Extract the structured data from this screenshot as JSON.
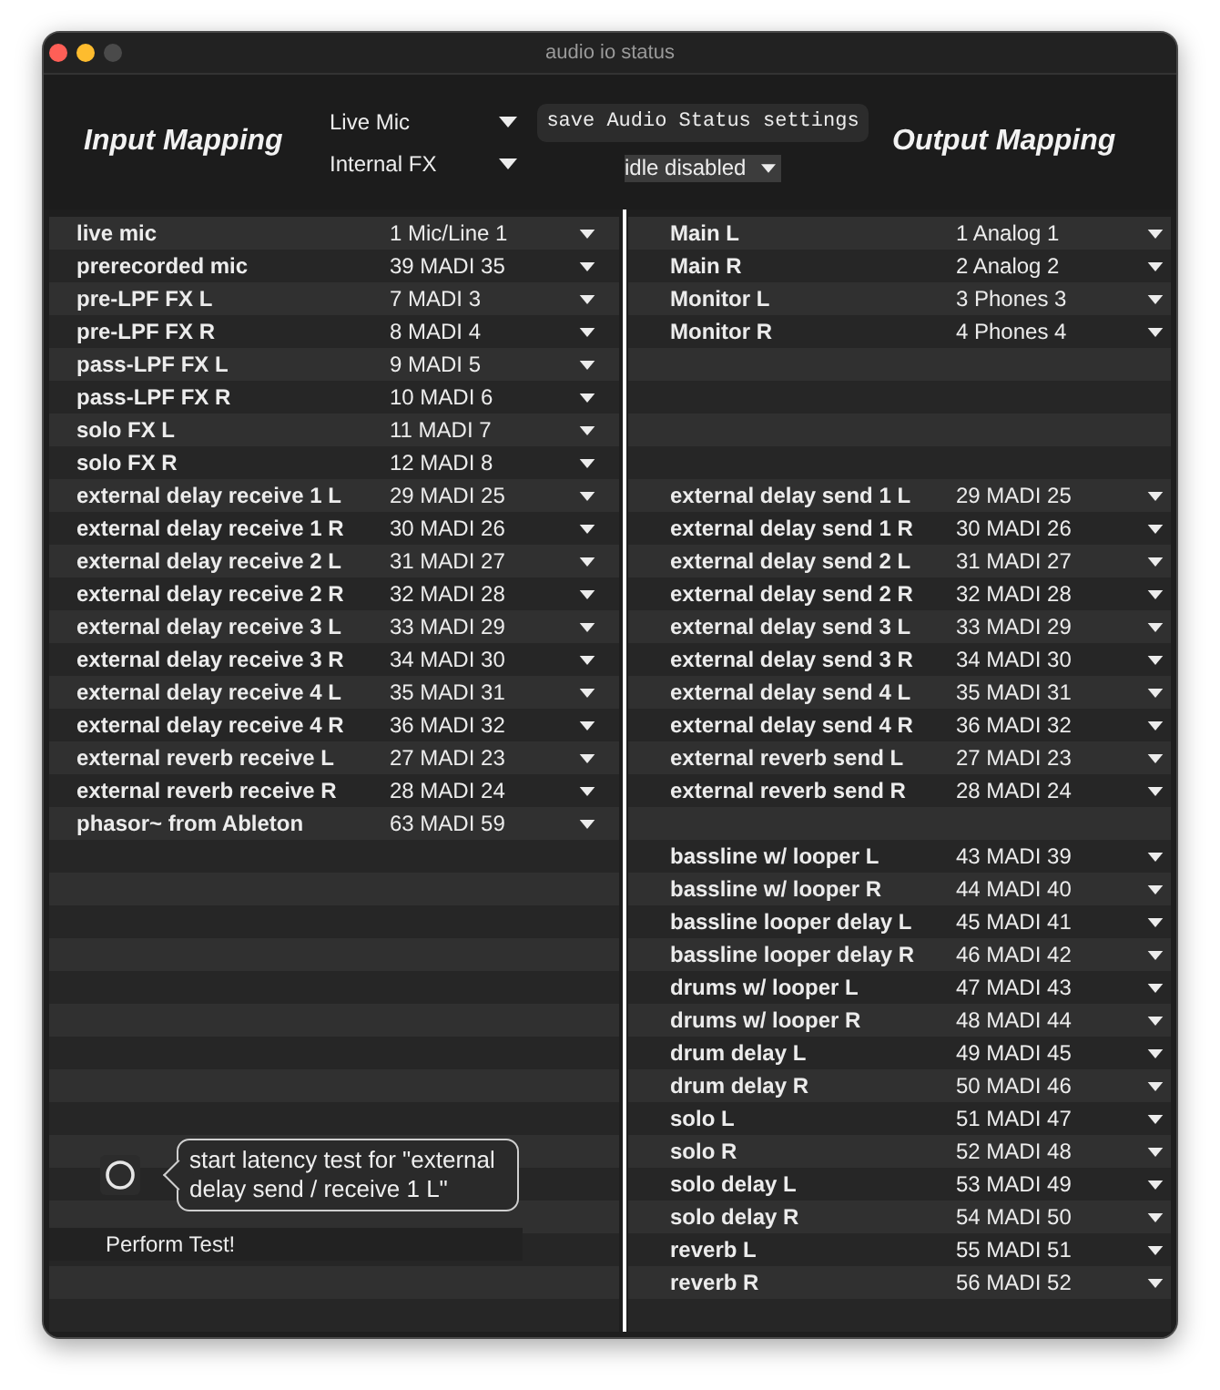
{
  "window": {
    "title": "audio io status"
  },
  "header": {
    "input_title": "Input Mapping",
    "source_menus": [
      {
        "value": "Live Mic"
      },
      {
        "value": "Internal FX"
      }
    ],
    "save_button": "save Audio Status settings",
    "idle_menu": {
      "value": "idle disabled"
    },
    "output_title": "Output Mapping"
  },
  "inputs": [
    {
      "kind": "mapping",
      "name": "live mic",
      "channel": "1 Mic/Line 1"
    },
    {
      "kind": "mapping",
      "name": "prerecorded mic",
      "channel": "39 MADI 35"
    },
    {
      "kind": "mapping",
      "name": "pre-LPF FX L",
      "channel": "7 MADI 3"
    },
    {
      "kind": "mapping",
      "name": "pre-LPF FX R",
      "channel": "8 MADI 4"
    },
    {
      "kind": "mapping",
      "name": "pass-LPF FX L",
      "channel": "9 MADI 5"
    },
    {
      "kind": "mapping",
      "name": "pass-LPF FX R",
      "channel": "10 MADI 6"
    },
    {
      "kind": "mapping",
      "name": "solo FX L",
      "channel": "11 MADI 7"
    },
    {
      "kind": "mapping",
      "name": "solo FX R",
      "channel": "12 MADI 8"
    },
    {
      "kind": "mapping",
      "name": "external delay receive 1 L",
      "channel": "29 MADI 25"
    },
    {
      "kind": "mapping",
      "name": "external delay receive 1 R",
      "channel": "30 MADI 26"
    },
    {
      "kind": "mapping",
      "name": "external delay receive 2 L",
      "channel": "31 MADI 27"
    },
    {
      "kind": "mapping",
      "name": "external delay receive 2 R",
      "channel": "32 MADI 28"
    },
    {
      "kind": "mapping",
      "name": "external delay receive 3 L",
      "channel": "33 MADI 29"
    },
    {
      "kind": "mapping",
      "name": "external delay receive 3 R",
      "channel": "34 MADI 30"
    },
    {
      "kind": "mapping",
      "name": "external delay receive 4 L",
      "channel": "35 MADI 31"
    },
    {
      "kind": "mapping",
      "name": "external delay receive 4 R",
      "channel": "36 MADI 32"
    },
    {
      "kind": "mapping",
      "name": "external reverb receive L",
      "channel": "27 MADI 23"
    },
    {
      "kind": "mapping",
      "name": "external reverb receive R",
      "channel": "28 MADI 24"
    },
    {
      "kind": "mapping",
      "name": "phasor~ from Ableton",
      "channel": "63 MADI 59"
    },
    {
      "kind": "blank"
    },
    {
      "kind": "blank"
    },
    {
      "kind": "blank"
    },
    {
      "kind": "blank"
    },
    {
      "kind": "blank"
    },
    {
      "kind": "blank"
    },
    {
      "kind": "blank"
    },
    {
      "kind": "blank"
    },
    {
      "kind": "blank"
    },
    {
      "kind": "blank"
    },
    {
      "kind": "blank"
    },
    {
      "kind": "blank"
    },
    {
      "kind": "blank"
    },
    {
      "kind": "blank"
    },
    {
      "kind": "blank"
    }
  ],
  "latency_test": {
    "tooltip": "start latency test for \"external delay send / receive 1 L\"",
    "button": "Perform Test!"
  },
  "outputs": [
    {
      "kind": "mapping",
      "name": "Main L",
      "channel": "1 Analog 1"
    },
    {
      "kind": "mapping",
      "name": "Main R",
      "channel": "2 Analog 2"
    },
    {
      "kind": "mapping",
      "name": "Monitor L",
      "channel": "3 Phones 3"
    },
    {
      "kind": "mapping",
      "name": "Monitor R",
      "channel": "4 Phones 4"
    },
    {
      "kind": "blank"
    },
    {
      "kind": "blank"
    },
    {
      "kind": "blank"
    },
    {
      "kind": "blank"
    },
    {
      "kind": "mapping",
      "name": "external delay send 1 L",
      "channel": "29 MADI 25"
    },
    {
      "kind": "mapping",
      "name": "external delay send 1 R",
      "channel": "30 MADI 26"
    },
    {
      "kind": "mapping",
      "name": "external delay send 2 L",
      "channel": "31 MADI 27"
    },
    {
      "kind": "mapping",
      "name": "external delay send 2 R",
      "channel": "32 MADI 28"
    },
    {
      "kind": "mapping",
      "name": "external delay send 3 L",
      "channel": "33 MADI 29"
    },
    {
      "kind": "mapping",
      "name": "external delay send 3 R",
      "channel": "34 MADI 30"
    },
    {
      "kind": "mapping",
      "name": "external delay send 4 L",
      "channel": "35 MADI 31"
    },
    {
      "kind": "mapping",
      "name": "external delay send 4 R",
      "channel": "36 MADI 32"
    },
    {
      "kind": "mapping",
      "name": "external reverb send L",
      "channel": "27 MADI 23"
    },
    {
      "kind": "mapping",
      "name": "external reverb send R",
      "channel": "28 MADI 24"
    },
    {
      "kind": "blank"
    },
    {
      "kind": "mapping",
      "name": "bassline w/ looper L",
      "channel": "43 MADI 39"
    },
    {
      "kind": "mapping",
      "name": "bassline w/ looper R",
      "channel": "44 MADI 40"
    },
    {
      "kind": "mapping",
      "name": "bassline looper delay L",
      "channel": "45 MADI 41"
    },
    {
      "kind": "mapping",
      "name": "bassline looper delay R",
      "channel": "46 MADI 42"
    },
    {
      "kind": "mapping",
      "name": "drums w/ looper L",
      "channel": "47 MADI 43"
    },
    {
      "kind": "mapping",
      "name": "drums w/ looper R",
      "channel": "48 MADI 44"
    },
    {
      "kind": "mapping",
      "name": "drum delay L",
      "channel": "49 MADI 45"
    },
    {
      "kind": "mapping",
      "name": "drum delay R",
      "channel": "50 MADI 46"
    },
    {
      "kind": "mapping",
      "name": "solo L",
      "channel": "51 MADI 47"
    },
    {
      "kind": "mapping",
      "name": "solo R",
      "channel": "52 MADI 48"
    },
    {
      "kind": "mapping",
      "name": "solo delay L",
      "channel": "53 MADI 49"
    },
    {
      "kind": "mapping",
      "name": "solo delay R",
      "channel": "54 MADI 50"
    },
    {
      "kind": "mapping",
      "name": "reverb L",
      "channel": "55 MADI 51"
    },
    {
      "kind": "mapping",
      "name": "reverb R",
      "channel": "56 MADI 52"
    },
    {
      "kind": "blank"
    }
  ]
}
